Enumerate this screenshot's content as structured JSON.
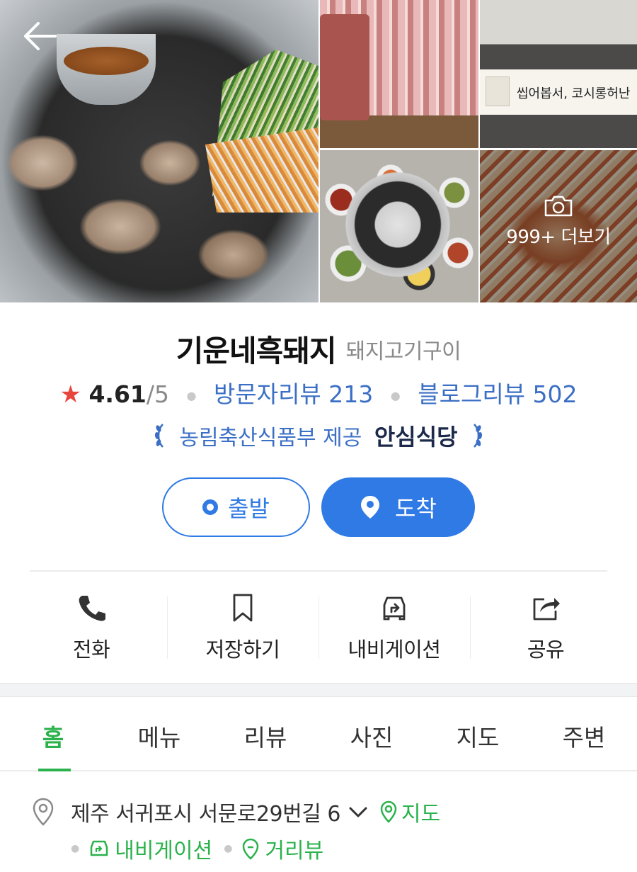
{
  "gallery": {
    "more_label": "999+ 더보기",
    "sign_text": "씹어봅서, 코시롱허난"
  },
  "place": {
    "name": "기운네흑돼지",
    "category": "돼지고기구이"
  },
  "rating": {
    "star": "★",
    "value": "4.61",
    "max": "/5",
    "visitor_review": "방문자리뷰 213",
    "blog_review": "블로그리뷰 502"
  },
  "certification": {
    "provider": "농림축산식품부 제공",
    "badge": "안심식당"
  },
  "route": {
    "depart_label": "출발",
    "arrive_label": "도착"
  },
  "actions": [
    {
      "label": "전화",
      "icon": "phone-icon"
    },
    {
      "label": "저장하기",
      "icon": "bookmark-icon"
    },
    {
      "label": "내비게이션",
      "icon": "car-navigation-icon"
    },
    {
      "label": "공유",
      "icon": "share-icon"
    }
  ],
  "tabs": [
    {
      "label": "홈",
      "active": true
    },
    {
      "label": "메뉴",
      "active": false
    },
    {
      "label": "리뷰",
      "active": false
    },
    {
      "label": "사진",
      "active": false
    },
    {
      "label": "지도",
      "active": false
    },
    {
      "label": "주변",
      "active": false
    }
  ],
  "address": {
    "text": "제주 서귀포시 서문로29번길 6",
    "map_link": "지도",
    "navigation_link": "내비게이션",
    "street_view_link": "거리뷰"
  },
  "colors": {
    "accent_blue": "#2f7ae5",
    "link_blue": "#3b6fc5",
    "accent_green": "#2bb24c",
    "star_red": "#e8453c"
  }
}
